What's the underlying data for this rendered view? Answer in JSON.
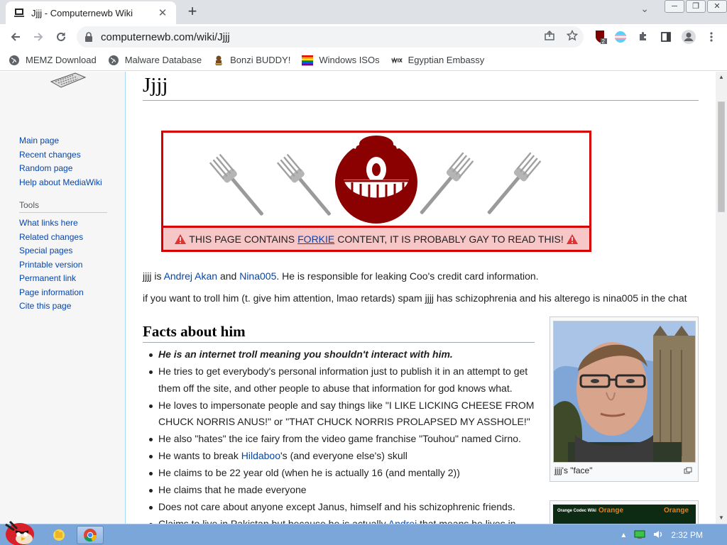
{
  "browser": {
    "tab_title": "Jjjj - Computernewb Wiki",
    "tab_close": "✕",
    "new_tab": "+",
    "url": "computernewb.com/wiki/Jjjj",
    "tab_search": "⌄",
    "extension_badge": "2",
    "window_controls": [
      "─",
      "❐",
      "✕"
    ]
  },
  "bookmarks": [
    {
      "label": "MEMZ Download",
      "icon": "globe-icon"
    },
    {
      "label": "Malware Database",
      "icon": "globe-icon"
    },
    {
      "label": "Bonzi BUDDY!",
      "icon": "bonzi-icon"
    },
    {
      "label": "Windows ISOs",
      "icon": "rainbow-icon"
    },
    {
      "label": "Egyptian Embassy",
      "icon": "wix-icon"
    }
  ],
  "sidebar": {
    "nav": [
      "Main page",
      "Recent changes",
      "Random page",
      "Help about MediaWiki"
    ],
    "tools_heading": "Tools",
    "tools": [
      "What links here",
      "Related changes",
      "Special pages",
      "Printable version",
      "Permanent link",
      "Page information",
      "Cite this page"
    ]
  },
  "page": {
    "title": "Jjjj",
    "warning": {
      "prefix": "THIS PAGE CONTAINS",
      "link": "FORKIE",
      "suffix": "CONTENT, IT IS PROBABLY GAY TO READ THIS!"
    },
    "intro": {
      "t1": "jjjj is ",
      "link1": "Andrej Akan",
      "t2": " and ",
      "link2": "Nina005",
      "t3": ". He is responsible for leaking Coo's credit card information."
    },
    "troll_line": "if you want to troll him (t. give him attention, lmao retards) spam jjjj has schizophrenia and his alterego is nina005 in the chat",
    "facts_heading": "Facts about him",
    "facts": {
      "f1": "He is an internet troll meaning you shouldn't interact with him.",
      "f2": "He tries to get everybody's personal information just to publish it in an attempt to get them off the site, and other people to abuse that information for god knows what.",
      "f3": "He loves to impersonate people and say things like \"I LIKE LICKING CHEESE FROM CHUCK NORRIS ANUS!\" or \"THAT CHUCK NORRIS PROLAPSED MY ASSHOLE!\"",
      "f4": "He also \"hates\" the ice fairy from the video game franchise \"Touhou\" named Cirno.",
      "f5_pre": "He wants to break ",
      "f5_link": "Hildaboo",
      "f5_post": "'s (and everyone else's) skull",
      "f6": "He claims to be 22 year old (when he is actually 16 (and mentally 2))",
      "f7": "He claims that he made everyone",
      "f8": "Does not care about anyone except Janus, himself and his schizophrenic friends.",
      "f9_pre": "Claims to live in Pakistan but because he is actually ",
      "f9_link": "Andrej",
      "f9_post": " that means he lives in"
    },
    "thumb_caption": "jjjj's \"face\"",
    "thumb2": {
      "t1": "Orange Codec Wiki",
      "t2": "Orange",
      "t3": "Orange"
    }
  },
  "taskbar": {
    "clock": "2:32 PM"
  },
  "colors": {
    "warning_border": "#d60000",
    "warning_strip": "#f7c6c6",
    "link": "#0645ad",
    "taskbar": "#7aa6da"
  }
}
